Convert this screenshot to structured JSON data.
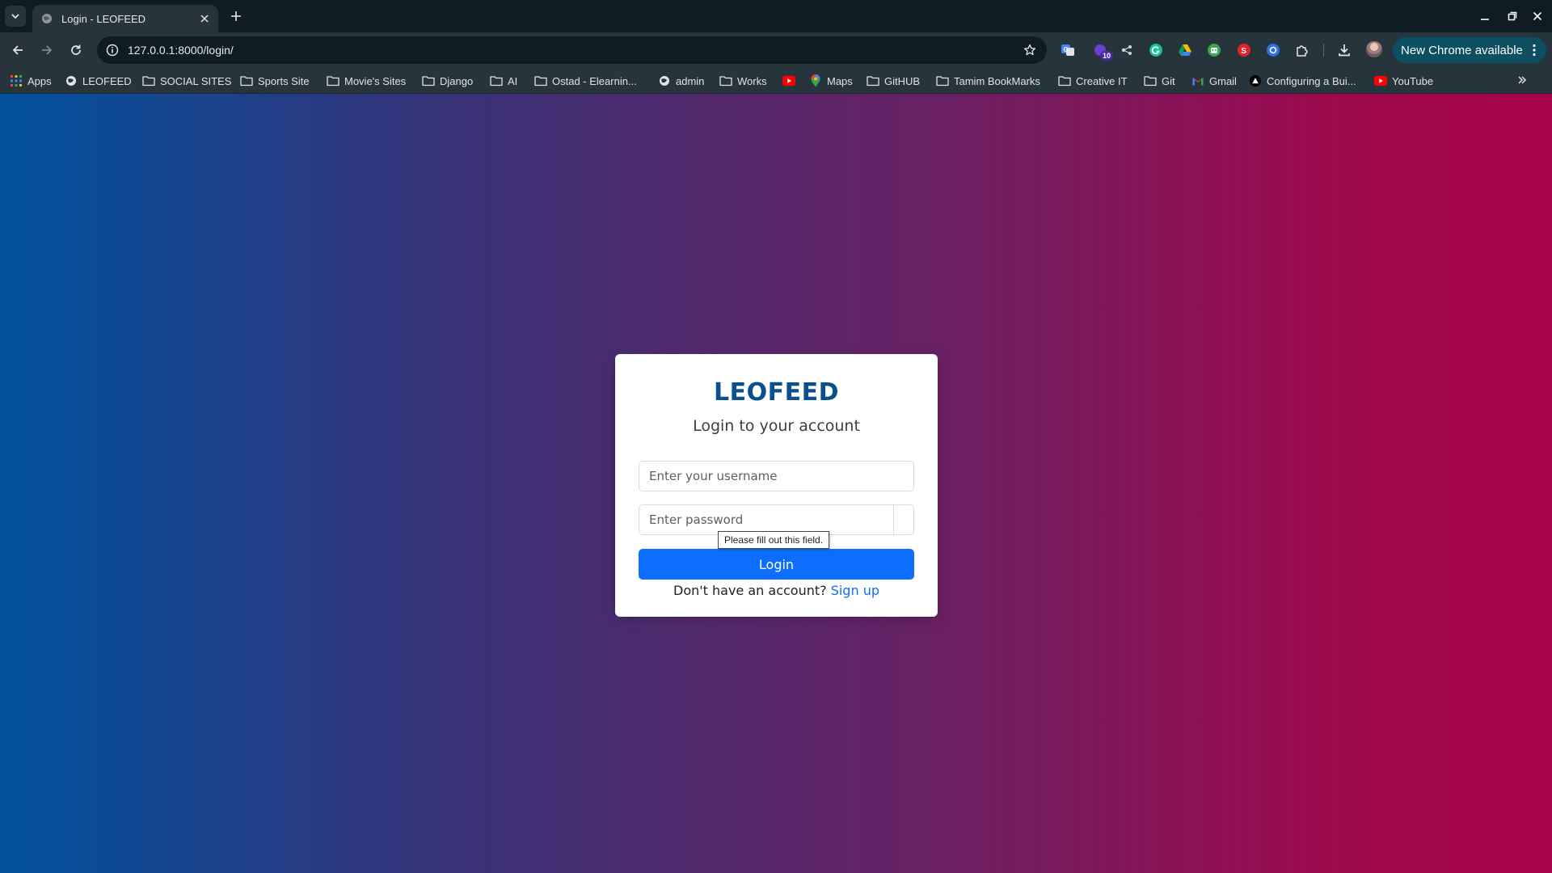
{
  "browser": {
    "tab": {
      "title": "Login - LEOFEED",
      "favicon": "globe-icon"
    },
    "address": {
      "url": "127.0.0.1:8000/login/"
    },
    "extensions": {
      "badge_count": "10"
    },
    "update_label": "New Chrome available"
  },
  "bookmarks": [
    {
      "label": "Apps",
      "icon": "apps-grid-icon"
    },
    {
      "label": "LEOFEED",
      "icon": "globe-icon"
    },
    {
      "label": "SOCIAL SITES",
      "icon": "folder-icon"
    },
    {
      "label": "Sports Site",
      "icon": "folder-icon"
    },
    {
      "label": "Movie's Sites",
      "icon": "folder-icon"
    },
    {
      "label": "Django",
      "icon": "folder-icon"
    },
    {
      "label": "AI",
      "icon": "folder-icon"
    },
    {
      "label": "Ostad - Elearnin...",
      "icon": "folder-icon"
    },
    {
      "label": "admin",
      "icon": "globe-icon"
    },
    {
      "label": "Works",
      "icon": "folder-icon"
    },
    {
      "label": "",
      "icon": "youtube-icon"
    },
    {
      "label": "Maps",
      "icon": "maps-pin-icon"
    },
    {
      "label": "GitHUB",
      "icon": "folder-icon"
    },
    {
      "label": "Tamim BookMarks",
      "icon": "folder-icon"
    },
    {
      "label": "Creative IT",
      "icon": "folder-icon"
    },
    {
      "label": "Git",
      "icon": "folder-icon"
    },
    {
      "label": "Gmail",
      "icon": "gmail-icon"
    },
    {
      "label": "Configuring a Bui...",
      "icon": "triangle-logo-icon"
    },
    {
      "label": "YouTube",
      "icon": "youtube-icon"
    }
  ],
  "login": {
    "brand": "LEOFEED",
    "subtitle": "Login to your account",
    "username_placeholder": "Enter your username",
    "password_placeholder": "Enter password",
    "validation_tooltip": "Please fill out this field.",
    "login_button": "Login",
    "signup_prompt": "Don't have an account?",
    "signup_link": "Sign up"
  },
  "colors": {
    "brand": "#0a4f8f",
    "primary_button": "#0d6efd",
    "gradient_left": "#01519d",
    "gradient_right": "#a8044a"
  }
}
